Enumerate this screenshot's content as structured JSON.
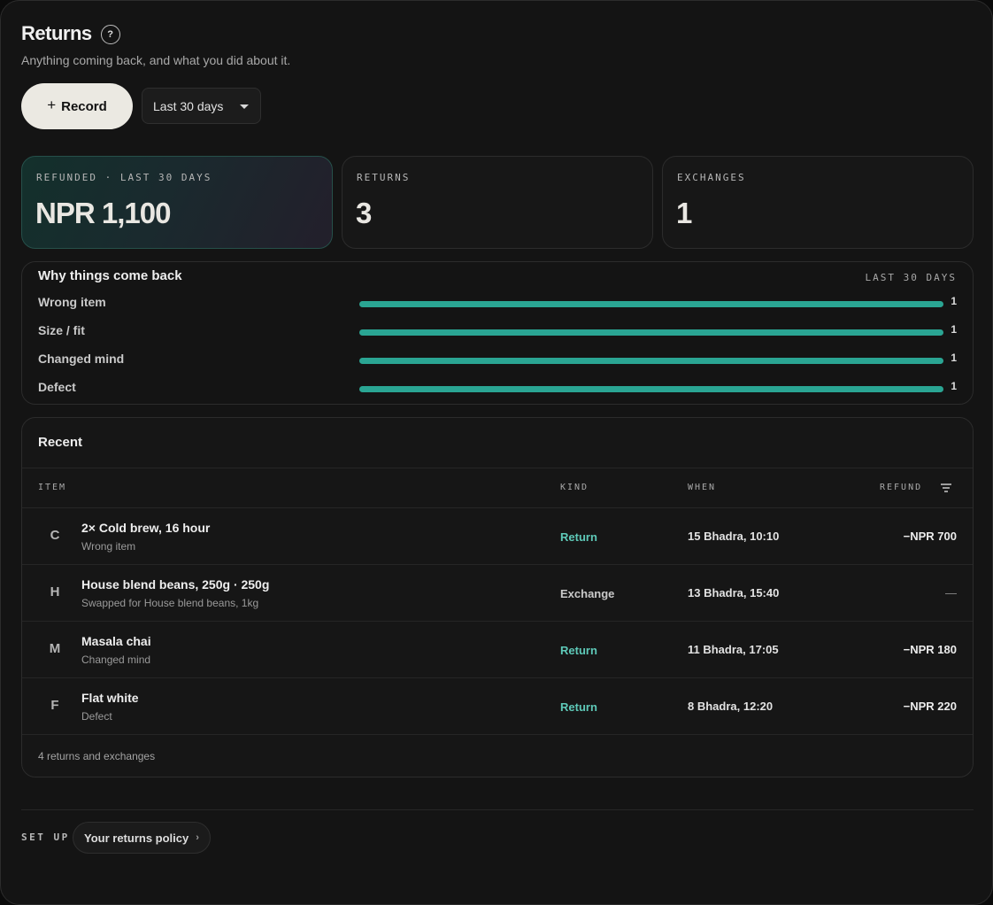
{
  "header": {
    "title": "Returns",
    "help_icon": "question-mark-icon",
    "subtitle": "Anything coming back, and what you did about it."
  },
  "toolbar": {
    "record_label": "Record",
    "record_icon": "plus-icon",
    "range_value": "Last 30 days"
  },
  "stats": [
    {
      "label": "REFUNDED · LAST 30 DAYS",
      "value": "NPR 1,100",
      "highlighted": true
    },
    {
      "label": "RETURNS",
      "value": "3"
    },
    {
      "label": "EXCHANGES",
      "value": "1"
    }
  ],
  "reasons": {
    "title": "Why things come back",
    "range": "LAST 30 DAYS",
    "bar_color": "#2aa593",
    "items": [
      {
        "label": "Wrong item",
        "count": 1,
        "fill": 1.0
      },
      {
        "label": "Size / fit",
        "count": 1,
        "fill": 1.0
      },
      {
        "label": "Changed mind",
        "count": 1,
        "fill": 1.0
      },
      {
        "label": "Defect",
        "count": 1,
        "fill": 1.0
      }
    ]
  },
  "recent": {
    "title": "Recent",
    "columns": {
      "item": "ITEM",
      "kind": "KIND",
      "when": "WHEN",
      "refund": "REFUND"
    },
    "filter_icon": "filter-icon",
    "kind_colors": {
      "Return": "#5ec9b8",
      "Exchange": "#c9c9c9"
    },
    "rows": [
      {
        "initial": "C",
        "name": "2× Cold brew, 16 hour",
        "note": "Wrong item",
        "kind": "Return",
        "when": "15 Bhadra, 10:10",
        "refund": "−NPR 700"
      },
      {
        "initial": "H",
        "name": "House blend beans, 250g · 250g",
        "note": "Swapped for House blend beans, 1kg",
        "kind": "Exchange",
        "when": "13 Bhadra, 15:40",
        "refund": "—"
      },
      {
        "initial": "M",
        "name": "Masala chai",
        "note": "Changed mind",
        "kind": "Return",
        "when": "11 Bhadra, 17:05",
        "refund": "−NPR 180"
      },
      {
        "initial": "F",
        "name": "Flat white",
        "note": "Defect",
        "kind": "Return",
        "when": "8 Bhadra, 12:20",
        "refund": "−NPR 220"
      }
    ],
    "footer": "4 returns and exchanges"
  },
  "setup": {
    "label": "SET UP",
    "policy_link": "Your returns policy",
    "policy_icon": "chevron-right-icon"
  }
}
